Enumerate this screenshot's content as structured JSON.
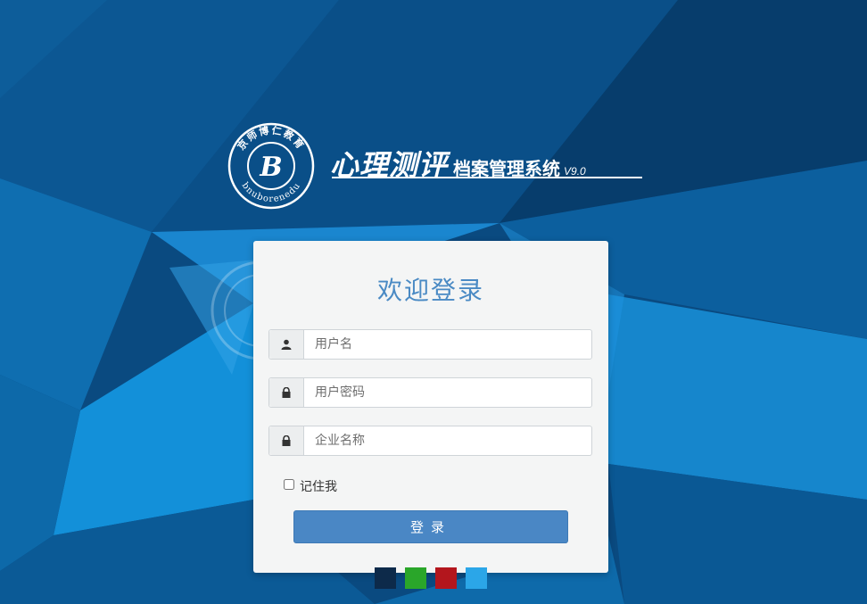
{
  "header": {
    "brand_main": "心理测评",
    "brand_sub": "档案管理系统",
    "version": "V9.0",
    "seal_top_text": "京师博仁教育",
    "seal_bottom_text": "bnuborenedu",
    "seal_letter": "B"
  },
  "login": {
    "title": "欢迎登录",
    "fields": [
      {
        "icon": "user-icon",
        "placeholder": "用户名",
        "value": ""
      },
      {
        "icon": "lock-icon",
        "placeholder": "用户密码",
        "value": ""
      },
      {
        "icon": "lock-icon",
        "placeholder": "企业名称",
        "value": ""
      }
    ],
    "remember_label": "记住我",
    "remember_checked": false,
    "submit_label": "登录"
  },
  "themes": {
    "colors": [
      "#0d2a4a",
      "#2aa62a",
      "#b3161d",
      "#2ba6e8"
    ]
  },
  "colors": {
    "background": "#0b4f88",
    "panel": "#f4f5f5",
    "accent": "#4a87c5",
    "title_text": "#4a8ac4"
  }
}
